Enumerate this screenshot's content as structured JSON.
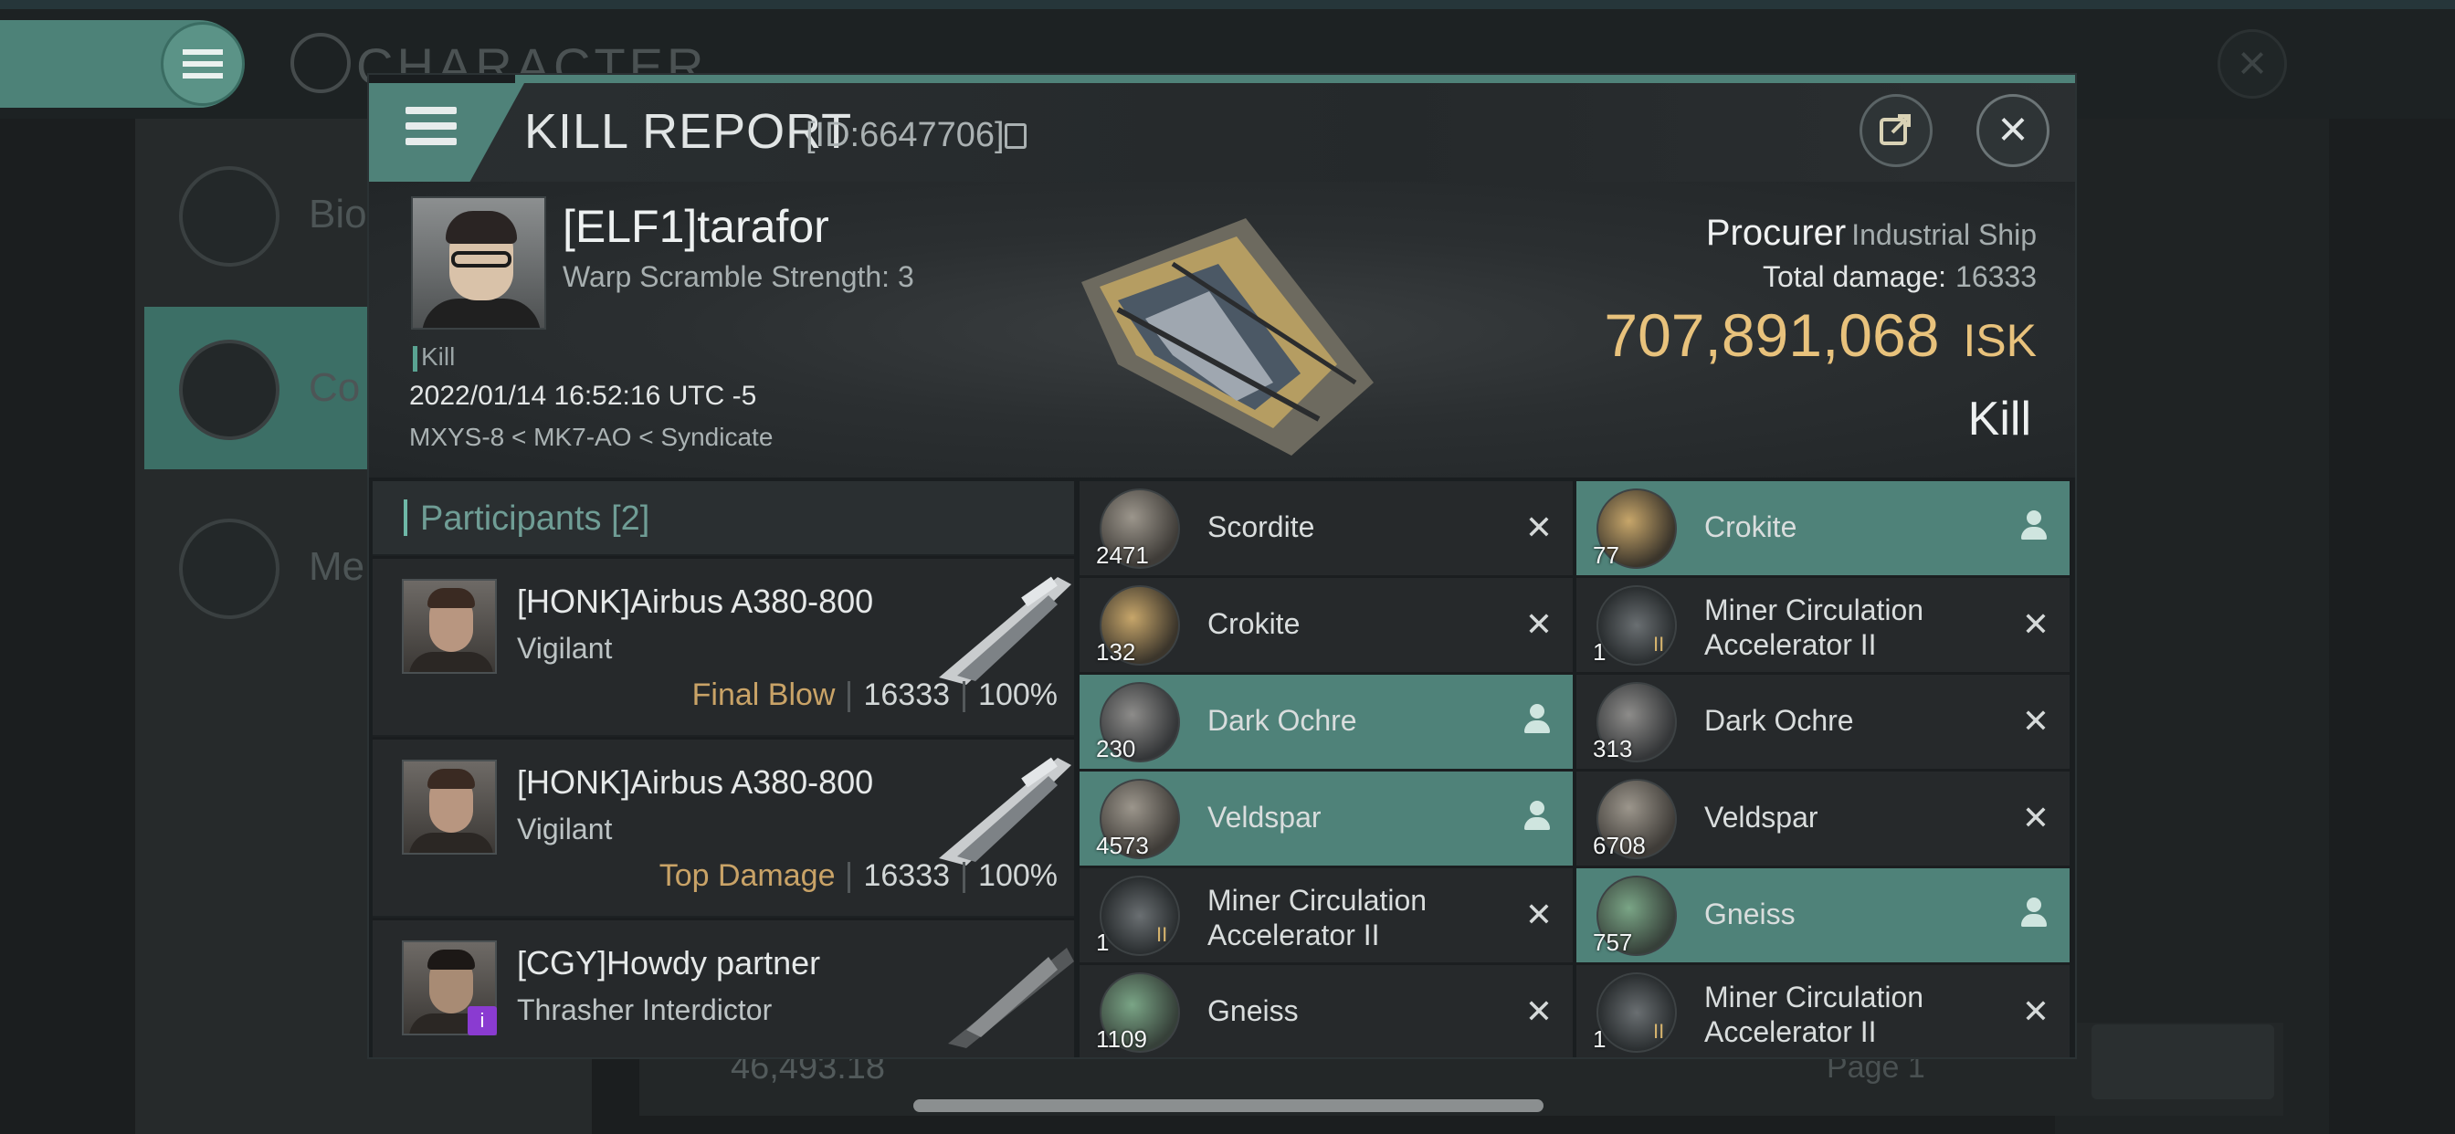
{
  "background": {
    "title": "CHARACTER",
    "sidebar_items": [
      "Bio",
      "Co",
      "Me"
    ],
    "wallet_value": "46,493.18",
    "page_label": "Page 1"
  },
  "modal": {
    "title": "KILL REPORT",
    "id_text": "[ID:6647706]",
    "victim": {
      "name": "[ELF1]tarafor",
      "subtitle": "Warp Scramble Strength: 3",
      "kill_tag": "Kill",
      "datetime": "2022/01/14 16:52:16 UTC -5",
      "location": "MXYS-8 < MK7-AO < Syndicate"
    },
    "ship": {
      "name": "Procurer",
      "class": "Industrial Ship",
      "total_damage_label": "Total damage:",
      "total_damage": "16333",
      "isk_value": "707,891,068",
      "isk_unit": "ISK",
      "result": "Kill"
    },
    "participants": {
      "label": "Participants",
      "count": "[2]",
      "rows": [
        {
          "name": "[HONK]Airbus A380-800",
          "ship": "Vigilant",
          "tag": "Final Blow",
          "damage": "16333",
          "pct": "100%"
        },
        {
          "name": "[HONK]Airbus A380-800",
          "ship": "Vigilant",
          "tag": "Top Damage",
          "damage": "16333",
          "pct": "100%"
        },
        {
          "name": "[CGY]Howdy partner",
          "ship": "Thrasher Interdictor",
          "tag": "",
          "damage": "",
          "pct": ""
        }
      ]
    },
    "items_left": [
      {
        "qty": "2471",
        "name": "Scordite",
        "state": "destroyed",
        "icon": "ore-icon"
      },
      {
        "qty": "132",
        "name": "Crokite",
        "state": "destroyed",
        "icon": "ore-icon"
      },
      {
        "qty": "230",
        "name": "Dark Ochre",
        "state": "dropped",
        "icon": "ore-icon"
      },
      {
        "qty": "4573",
        "name": "Veldspar",
        "state": "dropped",
        "icon": "ore-icon"
      },
      {
        "qty": "1",
        "name": "Miner Circulation Accelerator II",
        "state": "destroyed",
        "icon": "module-icon"
      },
      {
        "qty": "1109",
        "name": "Gneiss",
        "state": "destroyed",
        "icon": "ore-icon"
      }
    ],
    "items_right": [
      {
        "qty": "77",
        "name": "Crokite",
        "state": "dropped",
        "icon": "ore-icon"
      },
      {
        "qty": "1",
        "name": "Miner Circulation Accelerator II",
        "state": "destroyed",
        "icon": "module-icon"
      },
      {
        "qty": "313",
        "name": "Dark Ochre",
        "state": "destroyed",
        "icon": "ore-icon"
      },
      {
        "qty": "6708",
        "name": "Veldspar",
        "state": "destroyed",
        "icon": "ore-icon"
      },
      {
        "qty": "757",
        "name": "Gneiss",
        "state": "dropped",
        "icon": "ore-icon"
      },
      {
        "qty": "1",
        "name": "Miner Circulation Accelerator II",
        "state": "destroyed",
        "icon": "module-icon"
      }
    ],
    "colors": {
      "accent": "#4f8279",
      "isk": "#e8c27c",
      "tag": "#c9a367"
    }
  }
}
